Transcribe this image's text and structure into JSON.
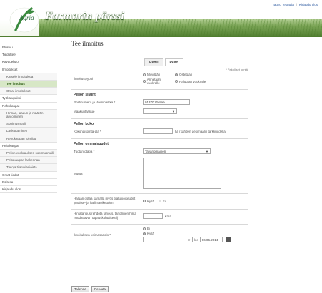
{
  "user_bar": {
    "name": "Tauno Testaaja",
    "logout": "Kirjaudu ulos"
  },
  "header": {
    "site_title": "Farmarin pörssi",
    "logo_text": "Agria"
  },
  "sidebar": {
    "items": [
      {
        "label": "Etusivu",
        "type": "top"
      },
      {
        "label": "Tiedotteet",
        "type": "top"
      },
      {
        "label": "Käyttöehdot",
        "type": "top"
      },
      {
        "label": "Ilmoitukset",
        "type": "top"
      },
      {
        "label": "Katsele ilmoituksia",
        "type": "sub"
      },
      {
        "label": "Tee ilmoitus",
        "type": "sub",
        "active": true
      },
      {
        "label": "Omat ilmoitukset",
        "type": "sub"
      },
      {
        "label": "Työkalupakki",
        "type": "top"
      },
      {
        "label": "Rehukaupat",
        "type": "top"
      },
      {
        "label": "Hinnan, laadun ja määrän arvioiminen",
        "type": "sub"
      },
      {
        "label": "Sopimusmallit",
        "type": "sub"
      },
      {
        "label": "Laskuttaminen",
        "type": "sub"
      },
      {
        "label": "Rehukaupan toimijat",
        "type": "sub"
      },
      {
        "label": "Peltokaupat",
        "type": "top"
      },
      {
        "label": "Pellon vuokrauksen sopimusmalli",
        "type": "sub"
      },
      {
        "label": "Peltokaupan laskennan",
        "type": "sub"
      },
      {
        "label": "Tietoja tilatukiasioista",
        "type": "sub"
      },
      {
        "label": "Omat tiedot",
        "type": "top"
      },
      {
        "label": "Palaute",
        "type": "top"
      },
      {
        "label": "Kirjaudu ulos",
        "type": "top"
      }
    ]
  },
  "main": {
    "page_title": "Tee ilmoitus",
    "tabs": [
      {
        "label": "Rehu",
        "active": false
      },
      {
        "label": "Pelto",
        "active": true
      }
    ],
    "required_note": "* Pakolliset kentät",
    "ilmoitustyyppi": {
      "label": "Ilmoitustyyppi",
      "options": [
        {
          "label": "Myydään",
          "selected": false
        },
        {
          "label": "Ostetaan",
          "selected": true
        },
        {
          "label": "Annetaan vuokralle",
          "selected": false
        },
        {
          "label": "Halutaan vuokralle",
          "selected": false
        }
      ]
    },
    "sijainti": {
      "title": "Pellon sijainti",
      "postinumero_label": "Postinumero ja -toimipaikka *",
      "postinumero_value": "01370 Vantaa",
      "maakunta_label": "Maakunta/alue",
      "maakunta_value": ""
    },
    "koko": {
      "title": "Pellon koko",
      "ala_label": "Kokonaispinta-ala *",
      "ala_value": "",
      "ala_hint": "ha (kahden desimaalin tarkkuudella)"
    },
    "ominaisuudet": {
      "title": "Pellon ominaisuudet",
      "tuotantotapa_label": "Tuotantotapa *",
      "tuotantotapa_value": "Tavanomainen",
      "muuta_label": "Muuta",
      "muuta_value": ""
    },
    "tilatuki": {
      "label": "Haluan ostaa samalla myös tilatukioikeudet ymaitse- ja hallintaoikeuden",
      "options": [
        {
          "label": "Kyllä",
          "selected": false
        },
        {
          "label": "Ei",
          "selected": false
        }
      ]
    },
    "hintatarjous": {
      "label": "Hintatarjous (ehdota tarjous, tarjollinen hinta noudattavan tapauskohtaisesti)",
      "value": "",
      "unit": "€/ha"
    },
    "voimassa": {
      "label": "Ilmoituksen voimassaolo *",
      "options": [
        {
          "label": "Ei",
          "selected": false
        },
        {
          "label": "Kyllä",
          "selected": true
        }
      ],
      "date_prefix": "klo",
      "date_value": "06.06.2014"
    },
    "buttons": {
      "save": "Tallenna",
      "cancel": "Peruuta"
    }
  }
}
